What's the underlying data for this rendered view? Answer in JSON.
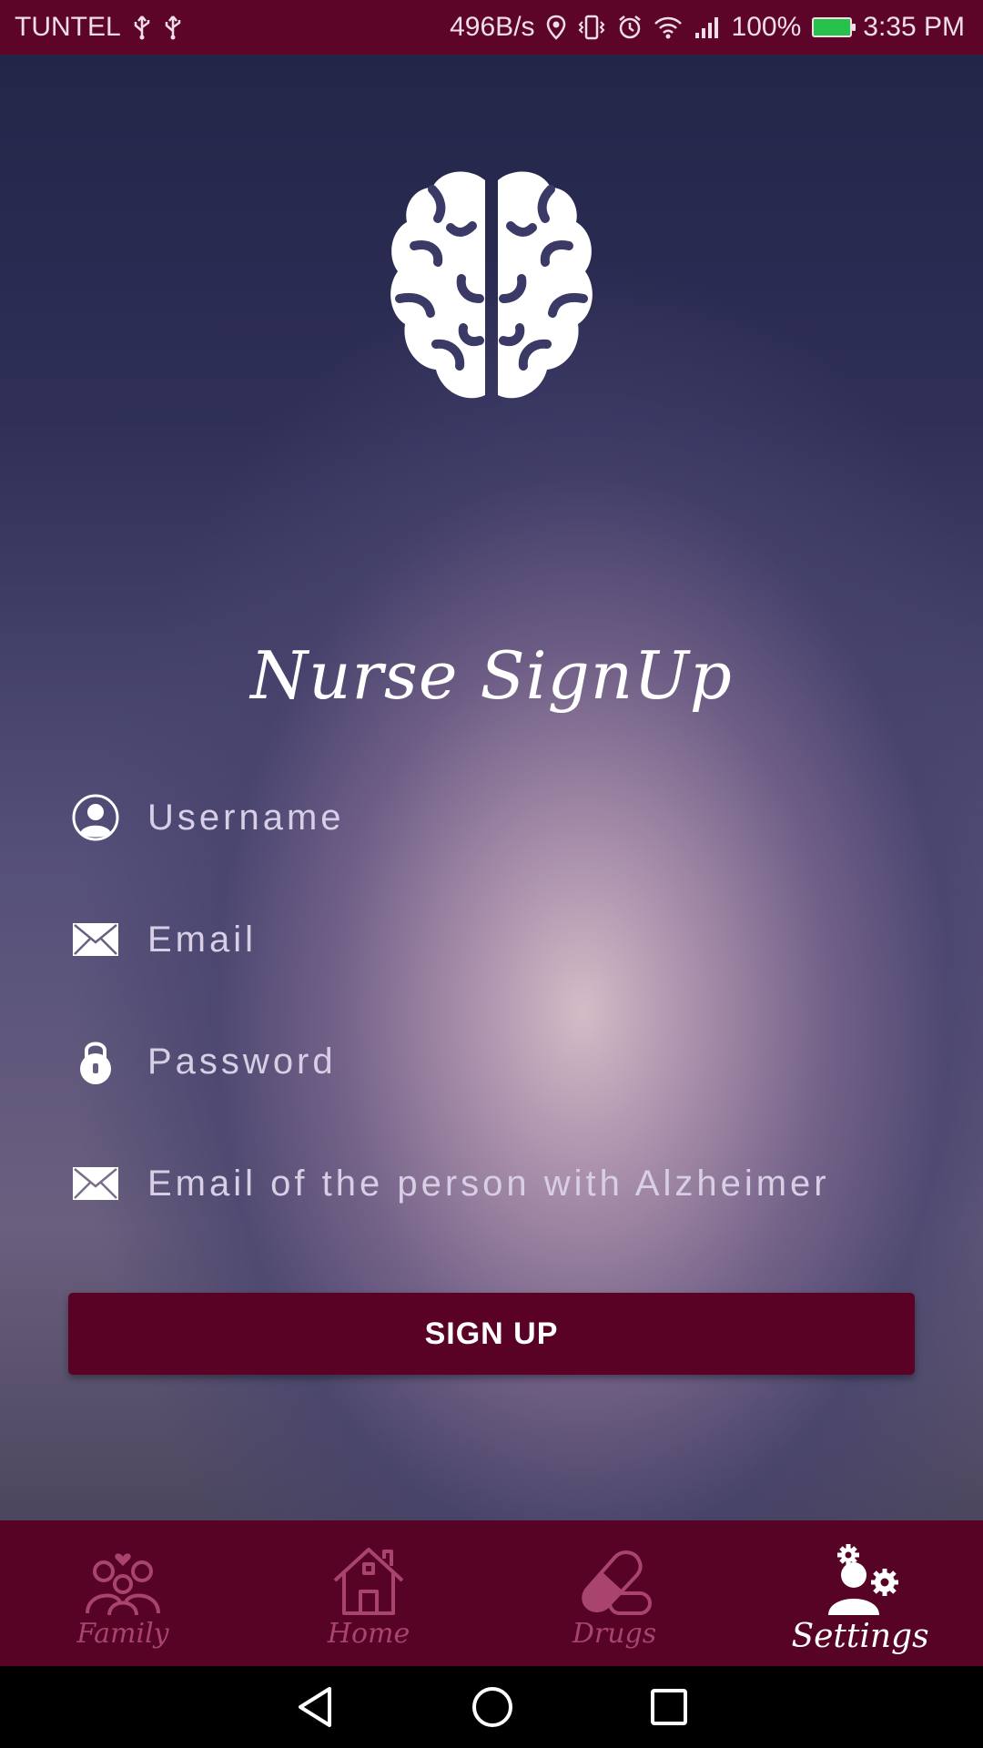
{
  "status_bar": {
    "carrier": "TUNTEL",
    "network_speed": "496B/s",
    "battery_percent": "100%",
    "time": "3:35 PM",
    "icons": [
      "usb-icon",
      "usb-icon",
      "location-icon",
      "vibrate-icon",
      "alarm-icon",
      "wifi-icon",
      "signal-icon",
      "battery-icon"
    ]
  },
  "title": "Nurse SignUp",
  "form": {
    "username_placeholder": "Username",
    "email_placeholder": "Email",
    "password_placeholder": "Password",
    "alz_email_placeholder": "Email of the person with Alzheimer",
    "signup_label": "SIGN UP"
  },
  "nav": {
    "items": [
      {
        "label": "Family",
        "icon": "family-icon",
        "active": false
      },
      {
        "label": "Home",
        "icon": "home-icon",
        "active": false
      },
      {
        "label": "Drugs",
        "icon": "pill-icon",
        "active": false
      },
      {
        "label": "Settings",
        "icon": "settings-user-icon",
        "active": true
      }
    ]
  },
  "colors": {
    "primary": "#5a0226",
    "status_bar": "#5c0528",
    "nav_inactive": "#a8446e",
    "nav_active": "#ffffff"
  }
}
